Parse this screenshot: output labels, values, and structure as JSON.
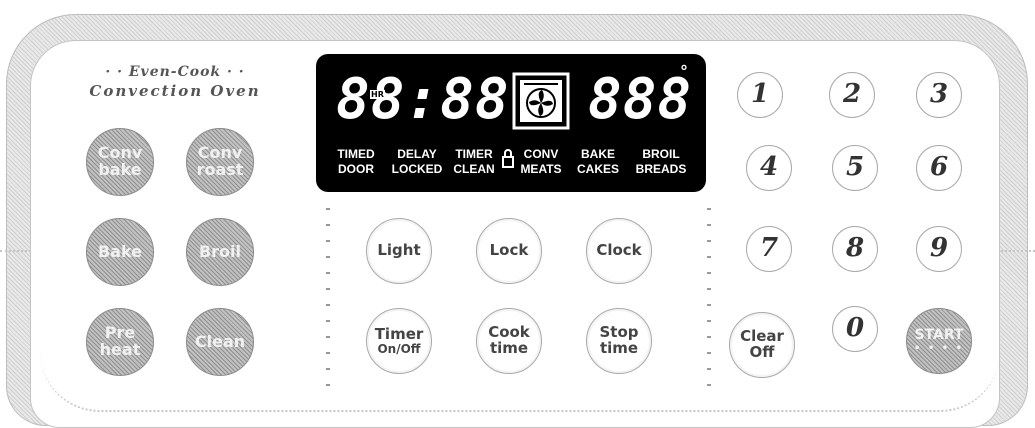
{
  "brand": {
    "line1": "· · Even-Cook · ·",
    "line2": "Convection Oven"
  },
  "display": {
    "time_digits": "88:88",
    "temp_digits": "888",
    "hr_tag": "HR",
    "degree": "°",
    "labels": {
      "timed": "TIMED",
      "door": "DOOR",
      "delay": "DELAY",
      "locked": "LOCKED",
      "timer": "TIMER",
      "clean": "CLEAN",
      "conv": "CONV",
      "meats": "MEATS",
      "bake": "BAKE",
      "cakes": "CAKES",
      "broil": "BROIL",
      "breads": "BREADS"
    }
  },
  "cook_keys": {
    "conv_bake": [
      "Conv",
      "bake"
    ],
    "conv_roast": [
      "Conv",
      "roast"
    ],
    "bake": "Bake",
    "broil": "Broil",
    "preheat": [
      "Pre",
      "heat"
    ],
    "clean": "Clean"
  },
  "function_keys": {
    "light": "Light",
    "lock": "Lock",
    "clock": "Clock",
    "timer": [
      "Timer",
      "On/Off"
    ],
    "cook_time": [
      "Cook",
      "time"
    ],
    "stop_time": [
      "Stop",
      "time"
    ]
  },
  "numpad": [
    "1",
    "2",
    "3",
    "4",
    "5",
    "6",
    "7",
    "8",
    "9",
    "0"
  ],
  "clear_off": [
    "Clear",
    "Off"
  ],
  "start": {
    "label": "START",
    "dots": "• • • •"
  },
  "colors": {
    "display_bg": "#000000",
    "grey_key": "#a8a8a8",
    "digit_color": "#ffffff"
  }
}
